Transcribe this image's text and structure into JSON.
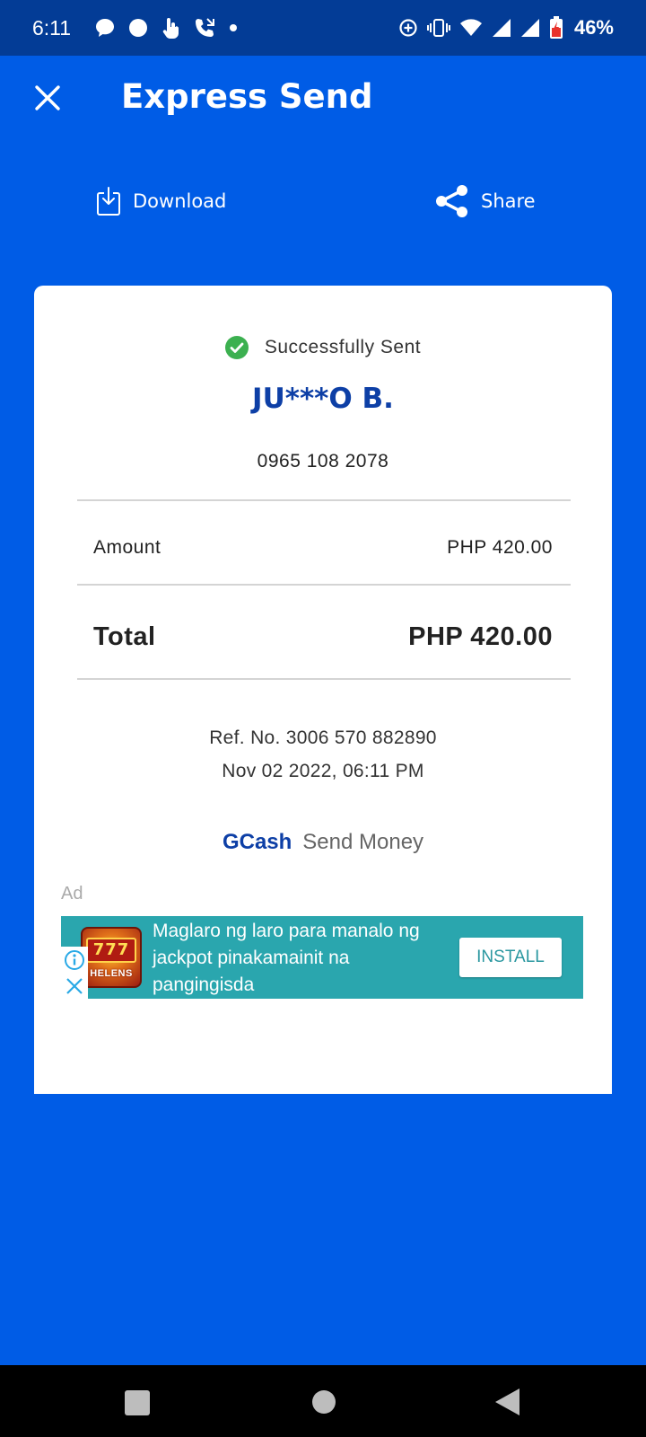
{
  "status_bar": {
    "time": "6:11",
    "battery_percent": "46%"
  },
  "header": {
    "title": "Express Send"
  },
  "actions": {
    "download_label": "Download",
    "share_label": "Share"
  },
  "receipt": {
    "status": "Successfully Sent",
    "recipient_name": "JU***O B.",
    "recipient_number": "0965 108 2078",
    "amount_label": "Amount",
    "amount_value": "PHP 420.00",
    "total_label": "Total",
    "total_value": "PHP 420.00",
    "ref_no": "Ref. No. 3006 570 882890",
    "datetime": "Nov 02 2022, 06:11 PM",
    "brand_name": "GCash",
    "brand_label": "Send Money"
  },
  "ad": {
    "label": "Ad",
    "app_icon_text": "777",
    "app_icon_brand": "HELENS",
    "text": "Maglaro ng laro para manalo ng jackpot pinakamainit na pangingisda",
    "install_label": "INSTALL"
  },
  "colors": {
    "background": "#005ce6",
    "status_bar": "#033c96",
    "brand_blue": "#0d3fa6",
    "success_green": "#3cb050",
    "ad_teal": "#2aa6ae"
  }
}
